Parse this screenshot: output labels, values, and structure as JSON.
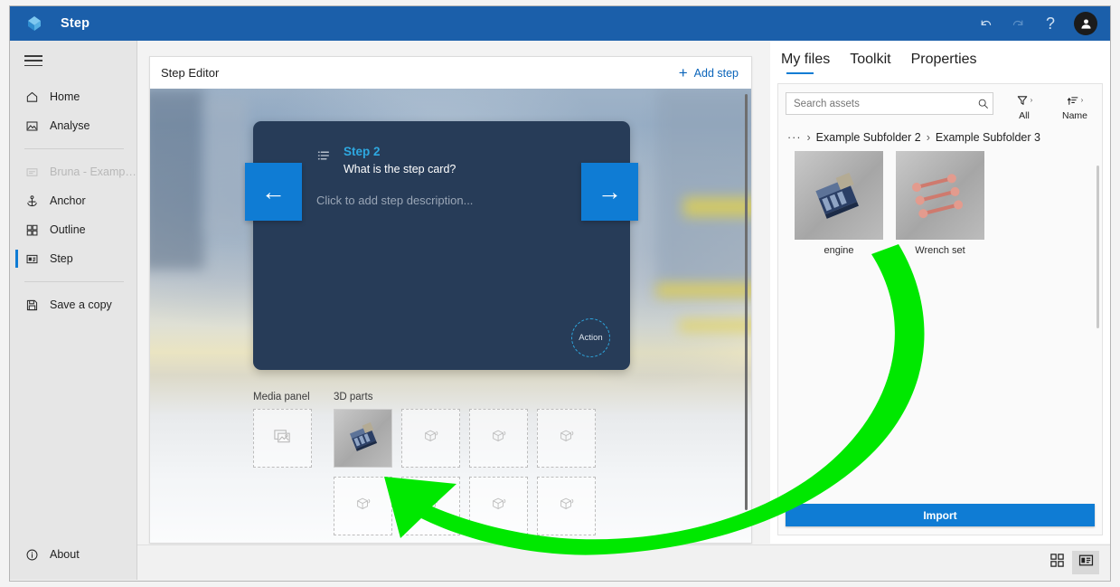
{
  "titlebar": {
    "app_title": "Step",
    "logo_icon": "step-logo-icon",
    "undo_icon": "undo-icon",
    "redo_icon": "redo-icon",
    "help_label": "?",
    "avatar_icon": "user-avatar-icon"
  },
  "sidebar": {
    "menu_icon": "hamburger-menu-icon",
    "items": [
      {
        "label": "Home",
        "icon": "home-icon",
        "state": "normal"
      },
      {
        "label": "Analyse",
        "icon": "analyse-image-icon",
        "state": "normal"
      },
      {
        "label": "Bruna - Example Gui...",
        "icon": "guide-icon",
        "state": "disabled"
      },
      {
        "label": "Anchor",
        "icon": "anchor-icon",
        "state": "normal"
      },
      {
        "label": "Outline",
        "icon": "outline-grid-icon",
        "state": "normal"
      },
      {
        "label": "Step",
        "icon": "step-card-icon",
        "state": "selected"
      },
      {
        "label": "Save a copy",
        "icon": "save-icon",
        "state": "normal"
      }
    ],
    "about": {
      "label": "About",
      "icon": "info-icon"
    }
  },
  "editor": {
    "title": "Step Editor",
    "add_step_label": "Add step",
    "add_step_icon": "plus-icon",
    "card": {
      "list_icon": "ordered-list-icon",
      "step_label": "Step 2",
      "step_title": "What is the step card?",
      "description_placeholder": "Click to add step description...",
      "action_label": "Action",
      "prev_icon": "arrow-left-icon",
      "next_icon": "arrow-right-icon",
      "accent_color": "#2ea8e0",
      "card_color": "#273c58",
      "button_color": "#0f7cd4"
    },
    "media_panel": {
      "title": "Media panel",
      "slots": [
        {
          "filled": false,
          "icon": "image-placeholder-icon"
        }
      ]
    },
    "parts_panel": {
      "title": "3D parts",
      "slots": [
        {
          "filled": true,
          "icon": "engine-thumbnail"
        },
        {
          "filled": false,
          "icon": "cube-placeholder-icon"
        },
        {
          "filled": false,
          "icon": "cube-placeholder-icon"
        },
        {
          "filled": false,
          "icon": "cube-placeholder-icon"
        },
        {
          "filled": false,
          "icon": "cube-placeholder-icon"
        },
        {
          "filled": false,
          "icon": "cube-placeholder-icon"
        },
        {
          "filled": false,
          "icon": "cube-placeholder-icon"
        },
        {
          "filled": false,
          "icon": "cube-placeholder-icon"
        }
      ]
    }
  },
  "right_panel": {
    "tabs": [
      {
        "label": "My files",
        "active": true
      },
      {
        "label": "Toolkit",
        "active": false
      },
      {
        "label": "Properties",
        "active": false
      }
    ],
    "search": {
      "value": "",
      "placeholder": "Search assets",
      "icon": "search-icon"
    },
    "filter": {
      "label": "All",
      "icon": "filter-icon",
      "caret": "›"
    },
    "sort": {
      "label": "Name",
      "icon": "sort-icon",
      "caret": "›"
    },
    "breadcrumb": {
      "overflow": "···",
      "separator": "›",
      "crumbs": [
        "Example Subfolder 2",
        "Example Subfolder 3"
      ]
    },
    "assets": [
      {
        "name": "engine",
        "icon": "engine-thumbnail"
      },
      {
        "name": "Wrench set",
        "icon": "wrench-set-thumbnail"
      }
    ],
    "import_label": "Import"
  },
  "bottombar": {
    "views": [
      {
        "icon": "grid-view-icon",
        "active": false
      },
      {
        "icon": "card-view-icon",
        "active": true
      }
    ]
  },
  "annotation": {
    "arrow_icon": "green-curved-arrow",
    "color": "#00e800"
  }
}
